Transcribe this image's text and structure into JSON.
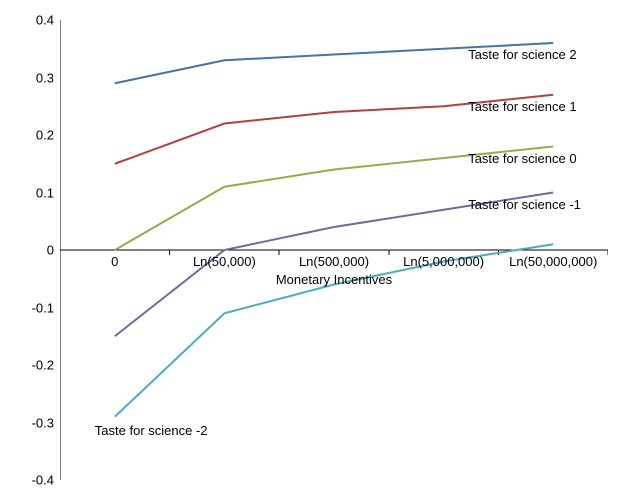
{
  "chart_data": {
    "type": "line",
    "xlabel": "Monetary Incentives",
    "ylabel": "",
    "title": "",
    "ylim": [
      -0.4,
      0.4
    ],
    "yticks": [
      -0.4,
      -0.3,
      -0.2,
      -0.1,
      0,
      0.1,
      0.2,
      0.3,
      0.4
    ],
    "categories": [
      "0",
      "Ln(50,000)",
      "Ln(500,000)",
      "Ln(5,000,000)",
      "Ln(50,000,000)"
    ],
    "series": [
      {
        "name": "Taste for science 2",
        "color": "#4573A7",
        "values": [
          0.29,
          0.33,
          0.34,
          0.35,
          0.36
        ]
      },
      {
        "name": "Taste for science 1",
        "color": "#B53F3E",
        "values": [
          0.15,
          0.22,
          0.24,
          0.25,
          0.27
        ]
      },
      {
        "name": "Taste for science 0",
        "color": "#94AD4A",
        "values": [
          0.0,
          0.11,
          0.14,
          0.16,
          0.18
        ]
      },
      {
        "name": "Taste for science -1",
        "color": "#7A65A0",
        "values": [
          -0.15,
          0.0,
          0.04,
          0.07,
          0.1
        ]
      },
      {
        "name": "Taste for science -2",
        "color": "#4CABC4",
        "values": [
          -0.29,
          -0.11,
          -0.06,
          -0.02,
          0.01
        ]
      }
    ]
  },
  "ytick_labels": [
    "-0.4",
    "-0.3",
    "-0.2",
    "-0.1",
    "0",
    "0.1",
    "0.2",
    "0.3",
    "0.4"
  ]
}
